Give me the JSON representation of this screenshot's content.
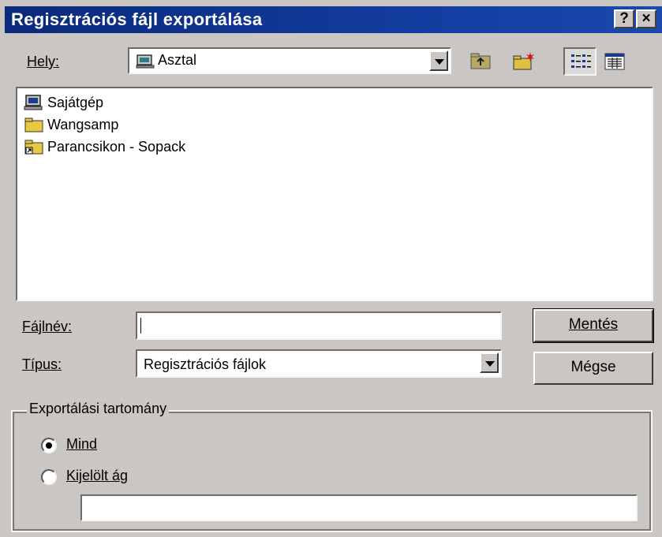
{
  "window": {
    "title": "Regisztrációs fájl exportálása",
    "help_button": "?",
    "close_button": "×"
  },
  "location": {
    "label": "Hely:",
    "value": "Asztal"
  },
  "files": [
    {
      "name": "Sajátgép",
      "icon": "computer-icon"
    },
    {
      "name": "Wangsamp",
      "icon": "folder-icon"
    },
    {
      "name": "Parancsikon - Sopack",
      "icon": "folder-shortcut-icon"
    }
  ],
  "filename": {
    "label": "Fájlnév:",
    "value": ""
  },
  "filetype": {
    "label": "Típus:",
    "value": "Regisztrációs fájlok"
  },
  "buttons": {
    "save": "Mentés",
    "cancel": "Mégse"
  },
  "export_range": {
    "title": "Exportálási tartomány",
    "option_all": "Mind",
    "option_selected": "Kijelölt ág",
    "selected_option": "Mind",
    "branch_value": ""
  },
  "colors": {
    "titlebar": "#123c9e",
    "face": "#c9c6c4"
  }
}
